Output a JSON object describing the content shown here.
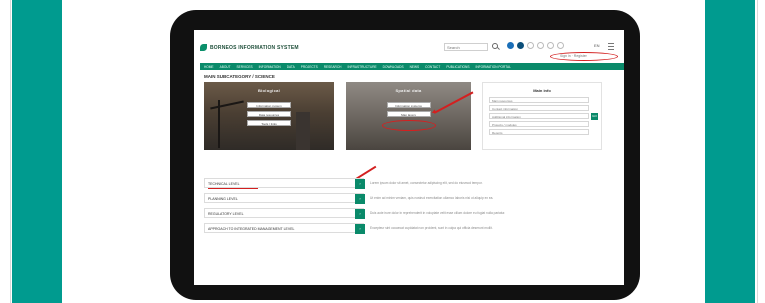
{
  "colors": {
    "teal": "#009b8f",
    "brand_green": "#0a8a6a",
    "annotation_red": "#d32020",
    "bezel": "#111111"
  },
  "header": {
    "logo_text": "BORNEOS INFORMATION SYSTEM",
    "search_placeholder": "Search",
    "language": "EN",
    "icons": [
      "user-icon",
      "help-icon",
      "globe-icon",
      "settings-icon",
      "notification-icon",
      "home-icon"
    ],
    "small_links": "Sign in  ·  Register"
  },
  "nav": {
    "items": [
      "Home",
      "About",
      "Services",
      "Information",
      "Data",
      "Projects",
      "Research",
      "Infrastructure",
      "Downloads",
      "News",
      "Contact",
      "Publications",
      "Information portal"
    ]
  },
  "page": {
    "title": "Main subcategory / Science"
  },
  "panels": [
    {
      "title": "Biological",
      "buttons": [
        "Information system",
        "Data resources",
        "Tools / links"
      ]
    },
    {
      "title": "Spatial data",
      "buttons": [
        "Information systems",
        "Map layers"
      ]
    }
  ],
  "sidebox": {
    "title": "Main info",
    "fields": [
      "Main resources",
      "Contact information",
      "Additional information",
      "Projects / modules",
      "Reports"
    ],
    "go_label": "GO"
  },
  "list": {
    "rows": [
      {
        "label": "Technical level",
        "button": "›",
        "description": "Lorem ipsum dolor sit amet, consectetur adipiscing elit, sed do eiusmod tempor."
      },
      {
        "label": "Planning level",
        "button": "›",
        "description": "Ut enim ad minim veniam, quis nostrud exercitation ullamco laboris nisi ut aliquip ex ea."
      },
      {
        "label": "Regulatory level",
        "button": "›",
        "description": "Duis aute irure dolor in reprehenderit in voluptate velit esse cillum dolore eu fugiat nulla pariatur."
      },
      {
        "label": "Approach to integrated management level",
        "button": "›",
        "description": "Excepteur sint occaecat cupidatat non proident, sunt in culpa qui officia deserunt mollit."
      }
    ]
  }
}
